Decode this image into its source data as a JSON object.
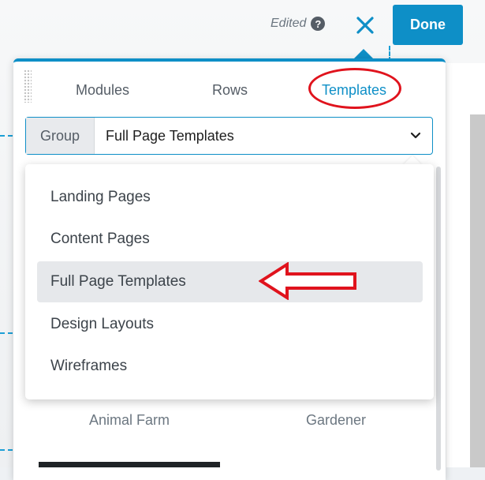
{
  "toolbar": {
    "edited_label": "Edited",
    "help_glyph": "?",
    "close_icon": "close-icon",
    "done_label": "Done",
    "accent_color": "#0e8fc7"
  },
  "panel": {
    "tabs": [
      {
        "label": "Modules",
        "active": false
      },
      {
        "label": "Rows",
        "active": false
      },
      {
        "label": "Templates",
        "active": true
      }
    ],
    "group_select": {
      "label": "Group",
      "value": "Full Page Templates"
    },
    "dropdown": {
      "options": [
        {
          "label": "Landing Pages",
          "selected": false
        },
        {
          "label": "Content Pages",
          "selected": false
        },
        {
          "label": "Full Page Templates",
          "selected": true
        },
        {
          "label": "Design Layouts",
          "selected": false
        },
        {
          "label": "Wireframes",
          "selected": false
        }
      ]
    },
    "templates": [
      {
        "label": "Animal Farm"
      },
      {
        "label": "Gardener"
      }
    ]
  },
  "annotations": {
    "highlight_color": "#e0131d"
  }
}
